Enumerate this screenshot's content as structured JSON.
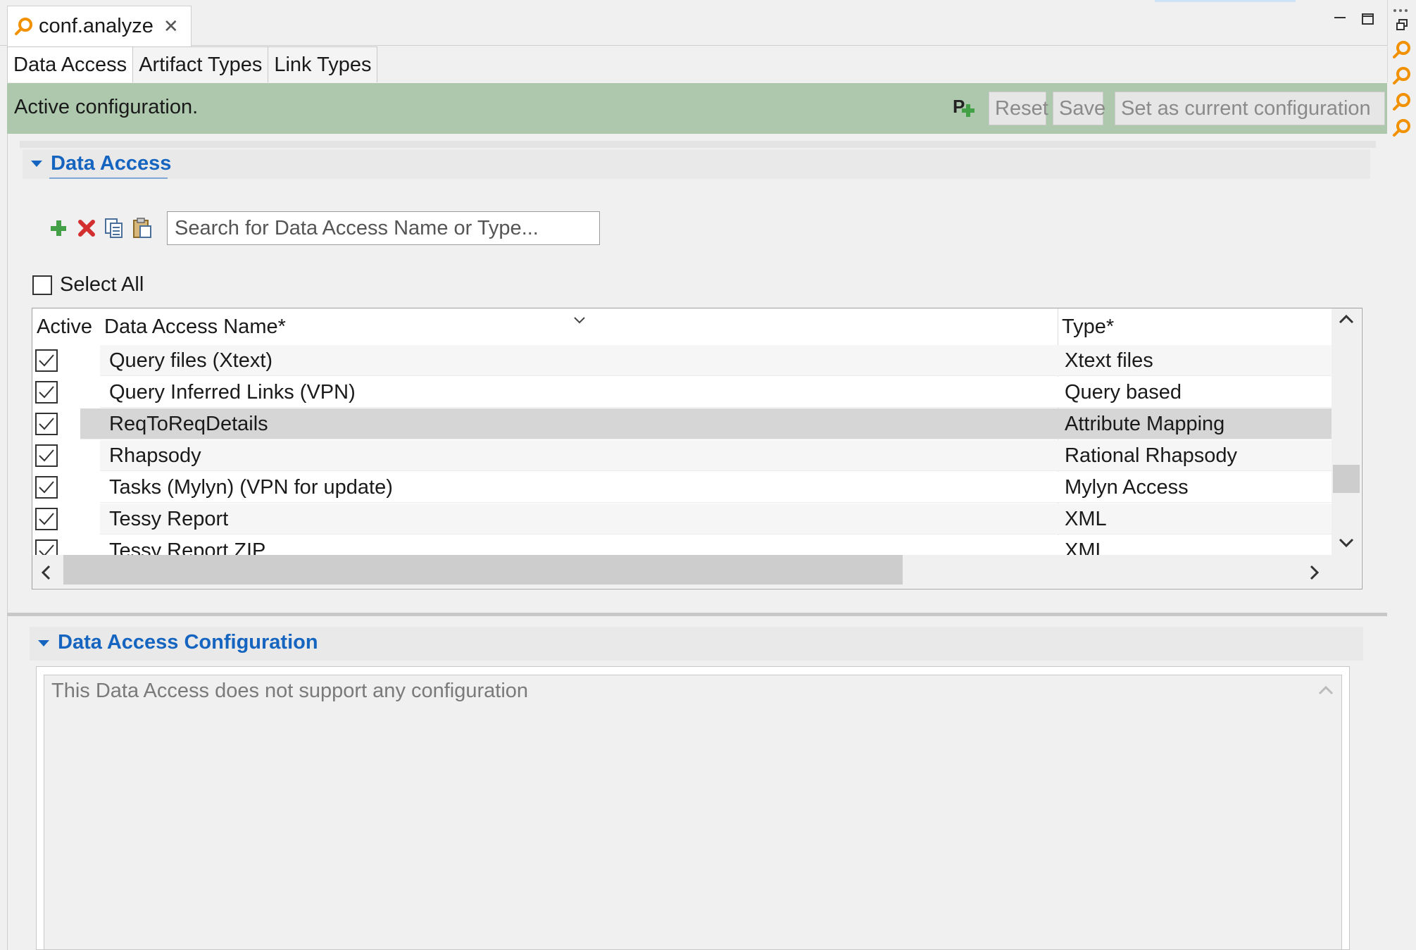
{
  "editor_tab": {
    "title": "conf.analyze",
    "close": "✕"
  },
  "page_tabs": [
    {
      "label": "Data Access"
    },
    {
      "label": "Artifact Types"
    },
    {
      "label": "Link Types"
    }
  ],
  "status": {
    "text": "Active configuration.",
    "buttons": {
      "reset": "Reset",
      "save": "Save",
      "set_current": "Set as current configuration"
    }
  },
  "data_access_section": {
    "title": "Data Access",
    "search_placeholder": "Search for Data Access Name or Type...",
    "select_all": "Select All",
    "columns": {
      "active": "Active",
      "name": "Data Access Name*",
      "type": "Type*"
    },
    "rows": [
      {
        "name": "Query files (Xtext)",
        "type": "Xtext files",
        "active": true,
        "selected": false
      },
      {
        "name": "Query Inferred Links (VPN)",
        "type": "Query based",
        "active": true,
        "selected": false
      },
      {
        "name": "ReqToReqDetails",
        "type": "Attribute Mapping",
        "active": true,
        "selected": true
      },
      {
        "name": "Rhapsody",
        "type": "Rational Rhapsody",
        "active": true,
        "selected": false
      },
      {
        "name": "Tasks (Mylyn) (VPN for update)",
        "type": "Mylyn Access",
        "active": true,
        "selected": false
      },
      {
        "name": "Tessy Report",
        "type": "XML",
        "active": true,
        "selected": false
      },
      {
        "name": "Tessy Report ZIP",
        "type": "XML",
        "active": true,
        "selected": false
      }
    ]
  },
  "config_section": {
    "title": "Data Access Configuration",
    "message": "This Data Access does not support any configuration"
  },
  "colors": {
    "status_bg": "#adc8ad",
    "section_title": "#1565c0",
    "accent_orange": "#f29100",
    "delete_red": "#d32f2f",
    "add_green": "#43a047"
  }
}
